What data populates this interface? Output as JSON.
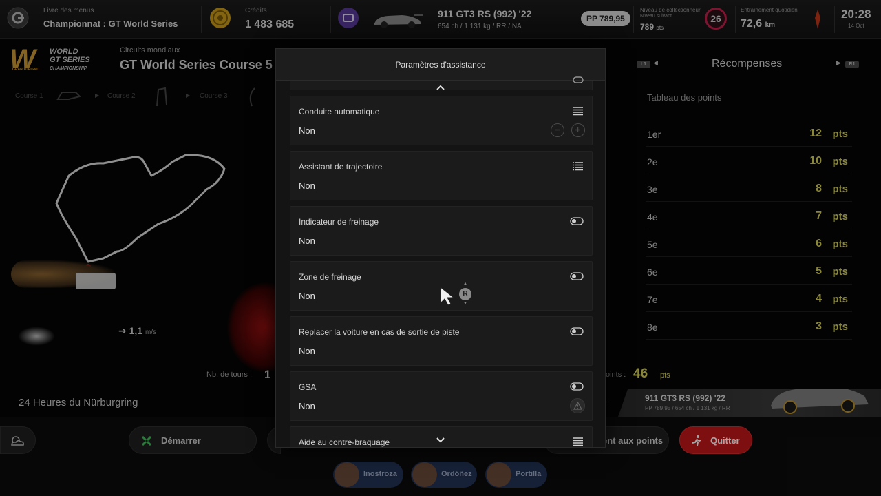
{
  "topbar": {
    "menu_book": {
      "small": "Livre des menus",
      "big": "Championnat : GT World Series"
    },
    "credits": {
      "small": "Crédits",
      "big": "1 483 685"
    },
    "car": {
      "name": "911 GT3 RS (992) '22",
      "specs": "654 ch / 1 131 kg / RR / NA",
      "pp": "PP 789,95"
    },
    "collector": {
      "small": "Niveau de collectionneur",
      "next": "Niveau suivant",
      "pts": "789",
      "pts_unit": "pts",
      "level": "26"
    },
    "training": {
      "small": "Entraînement quotidien",
      "big": "72,6",
      "unit": "km"
    },
    "clock": {
      "time": "20:28",
      "date": "14 Oct"
    }
  },
  "background_left": {
    "logo_lines": [
      "WORLD",
      "GT SERIES",
      "CHAMPIONSHIP"
    ],
    "logo_small": "GRAN TURISMO",
    "subtitle": "Circuits mondiaux",
    "title": "GT World Series Course 5",
    "race_tabs": [
      "Course 1",
      "Course 2",
      "Course 3"
    ],
    "speed_value": "1,1",
    "speed_unit": "m/s",
    "laps_label": "Nb. de tours :",
    "laps_value": "1",
    "track_name": "24 Heures du Nürburgring"
  },
  "background_right": {
    "rewards_title": "Récompenses",
    "l1": "L1",
    "r1": "R1",
    "points_table_title": "Tableau des points",
    "points": [
      {
        "place": "1er",
        "value": "12",
        "unit": "pts"
      },
      {
        "place": "2e",
        "value": "10",
        "unit": "pts"
      },
      {
        "place": "3e",
        "value": "8",
        "unit": "pts"
      },
      {
        "place": "4e",
        "value": "7",
        "unit": "pts"
      },
      {
        "place": "5e",
        "value": "6",
        "unit": "pts"
      },
      {
        "place": "6e",
        "value": "5",
        "unit": "pts"
      },
      {
        "place": "7e",
        "value": "4",
        "unit": "pts"
      },
      {
        "place": "8e",
        "value": "3",
        "unit": "pts"
      }
    ],
    "total_label": "oints :",
    "total_value": "46",
    "total_unit": "pts",
    "partial_label": "e",
    "car_name": "911 GT3 RS (992) '22",
    "car_specs": "PP 789,95 / 654 ch / 1 131 kg / RR"
  },
  "bottom": {
    "start_label": "Démarrer",
    "standings_label": "ent aux points",
    "quit_label": "Quitter",
    "drivers": [
      "Inostroza",
      "Ordóñez",
      "Portilla"
    ]
  },
  "modal": {
    "title": "Paramètres d'assistance",
    "rows": [
      {
        "label": "Conduite automatique",
        "value": "Non"
      },
      {
        "label": "Assistant de trajectoire",
        "value": "Non"
      },
      {
        "label": "Indicateur de freinage",
        "value": "Non"
      },
      {
        "label": "Zone de freinage",
        "value": "Non"
      },
      {
        "label": "Replacer la voiture en cas de sortie de piste",
        "value": "Non"
      },
      {
        "label": "GSA",
        "value": "Non"
      },
      {
        "label": "Aide au contre-braquage",
        "value": ""
      }
    ],
    "r_button": "R"
  },
  "colors": {
    "accent_points": "#d4d058",
    "quit": "#c0171a",
    "start_icon": "#3fbf5a",
    "collector_ring": "#c0204a"
  }
}
